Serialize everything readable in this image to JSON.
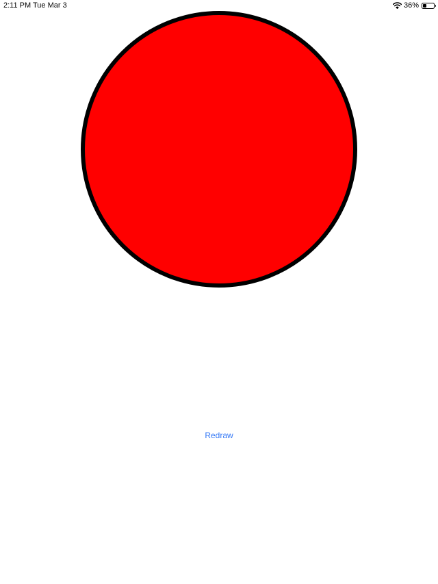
{
  "status_bar": {
    "time": "2:11 PM",
    "date": "Tue Mar 3",
    "battery_percent_label": "36%",
    "battery_level": 0.36,
    "icons": [
      "wifi-icon",
      "battery-icon"
    ]
  },
  "canvas": {
    "shape": "circle",
    "fill_color": "#ff0000",
    "stroke_color": "#000000"
  },
  "redraw_button": {
    "label": "Redraw",
    "color": "#3478f6"
  }
}
